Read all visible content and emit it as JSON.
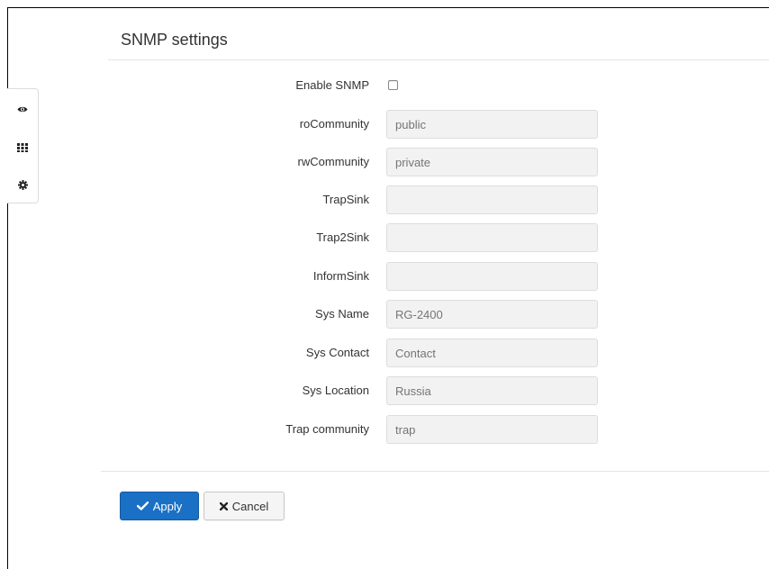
{
  "page": {
    "title": "SNMP settings"
  },
  "sidebar": {
    "items": [
      {
        "icon": "eye-icon"
      },
      {
        "icon": "grid-icon"
      },
      {
        "icon": "gear-icon"
      }
    ]
  },
  "form": {
    "enable_snmp": {
      "label": "Enable SNMP",
      "checked": false
    },
    "ro_community": {
      "label": "roCommunity",
      "placeholder": "public",
      "value": ""
    },
    "rw_community": {
      "label": "rwCommunity",
      "placeholder": "private",
      "value": ""
    },
    "trap_sink": {
      "label": "TrapSink",
      "placeholder": "",
      "value": ""
    },
    "trap2_sink": {
      "label": "Trap2Sink",
      "placeholder": "",
      "value": ""
    },
    "inform_sink": {
      "label": "InformSink",
      "placeholder": "",
      "value": ""
    },
    "sys_name": {
      "label": "Sys Name",
      "placeholder": "RG-2400",
      "value": ""
    },
    "sys_contact": {
      "label": "Sys Contact",
      "placeholder": "Contact",
      "value": ""
    },
    "sys_location": {
      "label": "Sys Location",
      "placeholder": "Russia",
      "value": ""
    },
    "trap_community": {
      "label": "Trap community",
      "placeholder": "trap",
      "value": ""
    }
  },
  "buttons": {
    "apply": "Apply",
    "cancel": "Cancel"
  },
  "colors": {
    "primary": "#1a70c4",
    "input_bg": "#f2f2f2"
  }
}
